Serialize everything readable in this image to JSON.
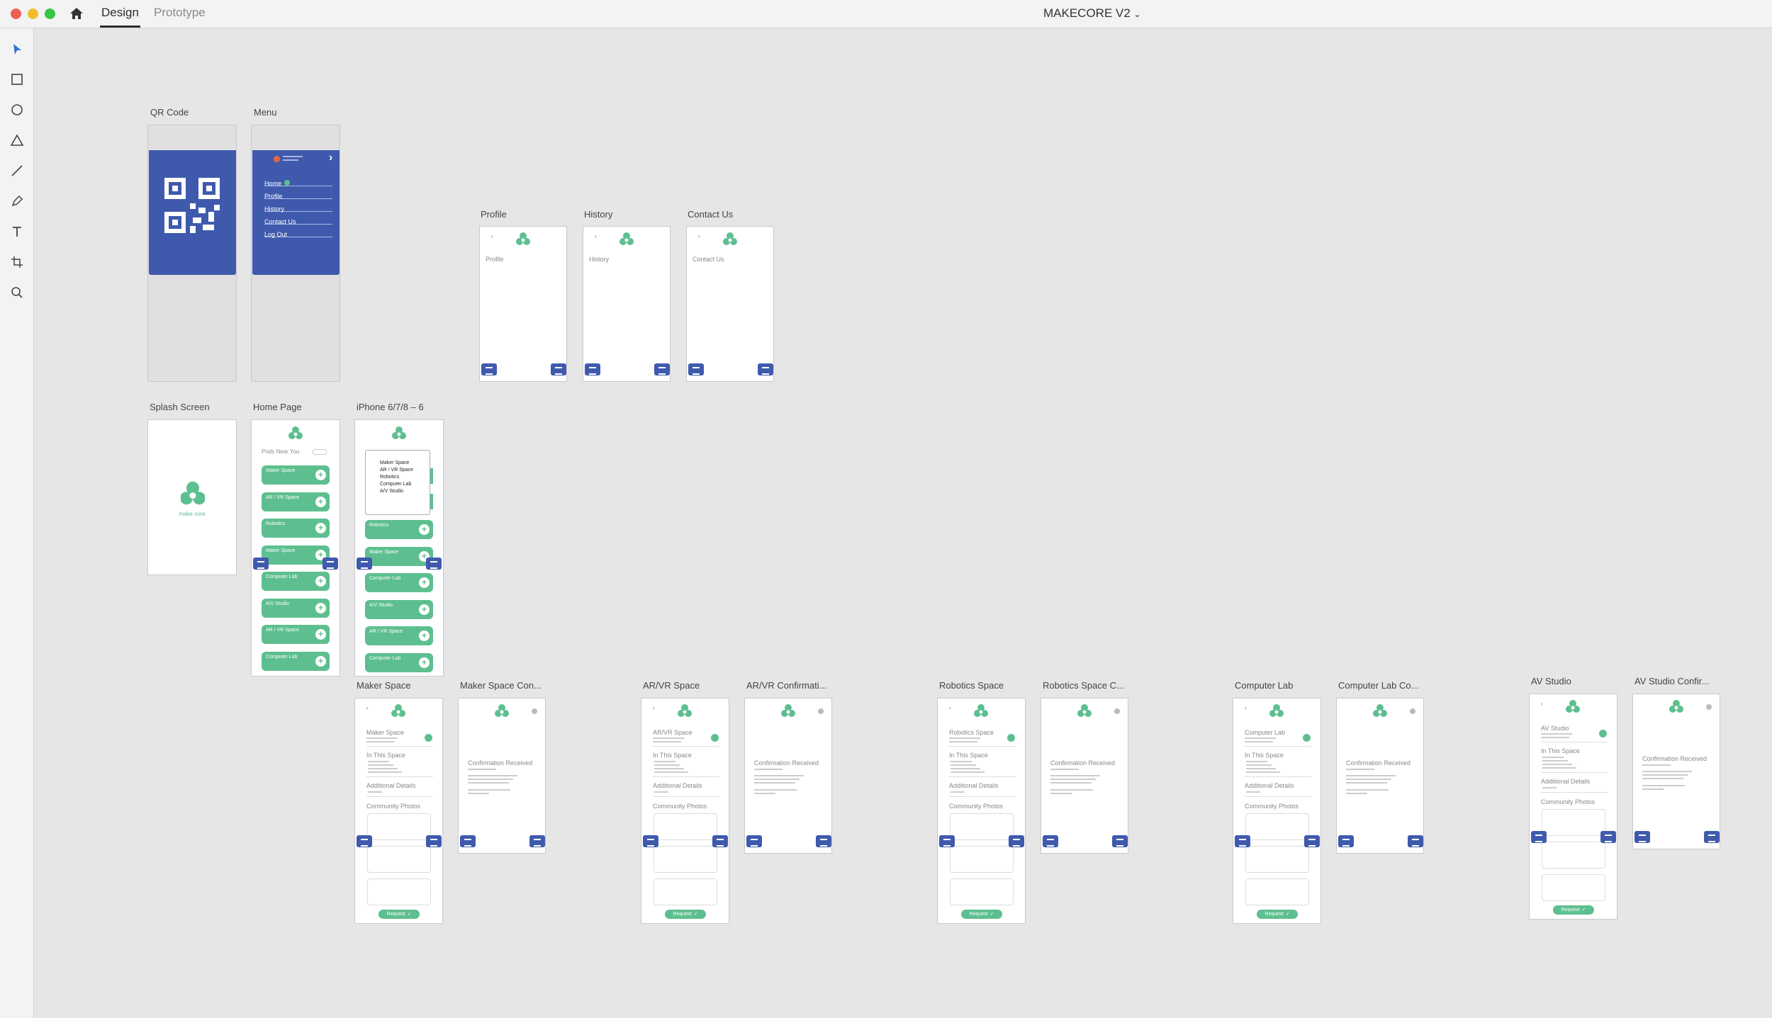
{
  "app": {
    "tabs": [
      "Design",
      "Prototype"
    ],
    "active_tab": "Design",
    "document_title": "MAKECORE V2",
    "colors": {
      "accent_blue": "#3f5aad",
      "brand_green": "#5dbf8f",
      "canvas": "#e6e6e6"
    }
  },
  "tools": [
    "select-tool-icon",
    "rectangle-tool-icon",
    "ellipse-tool-icon",
    "polygon-tool-icon",
    "line-tool-icon",
    "pen-tool-icon",
    "text-tool-icon",
    "artboard-tool-icon",
    "zoom-tool-icon"
  ],
  "artboards": {
    "qr": "QR Code",
    "menu": "Menu",
    "profile": "Profile",
    "history": "History",
    "contact": "Contact Us",
    "splash": "Splash Screen",
    "home": "Home Page",
    "iphone": "iPhone 6/7/8 – 6",
    "maker": "Maker Space",
    "maker_conf": "Maker Space Con...",
    "arvr": "AR/VR Space",
    "arvr_conf": "AR/VR Confirmati...",
    "robotics": "Robotics Space",
    "robotics_conf": "Robotics Space C...",
    "complab": "Computer Lab",
    "complab_conf": "Computer Lab Co...",
    "av": "AV Studio",
    "av_conf": "AV Studio Confir..."
  },
  "menu_items": [
    "Home",
    "Profile",
    "History",
    "Contact Us",
    "Log Out"
  ],
  "splash_text": "make core",
  "home": {
    "heading": "Pods Near You",
    "cards": [
      "Maker Space",
      "AR / VR Space",
      "Robotics",
      "Maker Space",
      "Computer Lab",
      "A/V Studio",
      "AR / VR Space",
      "Computer Lab"
    ]
  },
  "iphone": {
    "dropdown": [
      "Maker Space",
      "AR / VR Space",
      "Robotics",
      "Computer Lab",
      "A/V Studio"
    ],
    "cards": [
      "Robotics",
      "Maker Space",
      "Computer Lab",
      "A/V Studio",
      "AR / VR Space",
      "Computer Lab"
    ]
  },
  "detail": {
    "in_this_space": "In This Space",
    "additional": "Additional Details",
    "photos": "Community Photos",
    "request": "Request",
    "confirm": "Confirmation Received"
  },
  "space_titles": [
    "Maker Space",
    "AR/VR Space",
    "Robotics Space",
    "Computer Lab",
    "AV Studio"
  ]
}
